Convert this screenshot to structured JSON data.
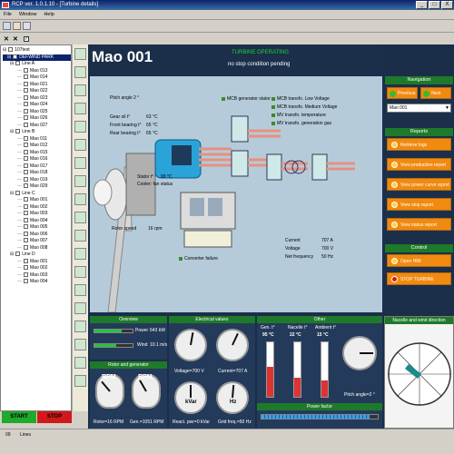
{
  "window": {
    "title": "RCP ver. 1.0.1.10 - [Turbine details]",
    "controls": [
      "_",
      "□",
      "X"
    ]
  },
  "menu": [
    "File",
    "Window",
    "Help"
  ],
  "tree": {
    "root": "107test",
    "park": "DEFWIND PARK",
    "lines": [
      {
        "label": "Line A",
        "items": [
          "Mao 013",
          "Mao 014",
          "Mao 021",
          "Mao 022",
          "Mao 023",
          "Mao 024",
          "Mao 025",
          "Mao 026",
          "Mao 027"
        ]
      },
      {
        "label": "Line B",
        "items": [
          "Mao 011",
          "Mao 012",
          "Mao 015",
          "Mao 016",
          "Mao 017",
          "Mao 018",
          "Mao 019",
          "Mao 029"
        ]
      },
      {
        "label": "Line C",
        "items": [
          "Mao 001",
          "Mao 002",
          "Mao 003",
          "Mao 004",
          "Mao 005",
          "Mao 006",
          "Mao 007",
          "Mao 008"
        ]
      },
      {
        "label": "Line D",
        "items": [
          "Mao 001",
          "Mao 002",
          "Mao 003",
          "Mao 004"
        ]
      }
    ]
  },
  "buttons": {
    "start": "START",
    "stop": "STOP"
  },
  "statusbar": {
    "left": "09",
    "right": "Lines"
  },
  "header": {
    "turbine": "Mao 001",
    "status": "TURBINE OPERATING",
    "substatus": "no stop condition pending"
  },
  "diagram": {
    "pitch_angle": "Pitch angle     2 °",
    "gear_oil": "Gear oil t°",
    "gear_oil_val": "63 °C",
    "front_bearing": "Front bearing t°",
    "front_bearing_val": "65 °C",
    "rear_bearing": "Rear bearing t°",
    "rear_bearing_val": "65 °C",
    "stator": "Stator t°",
    "stator_val": "90 °C",
    "cooler": "Cooler: fan status",
    "rotor_speed": "Rotor speed",
    "rotor_speed_val": "16 rpm",
    "converter_failure": "Converter failure",
    "legend": [
      "MCB generator stator",
      "MCB transfo. Low Voltage",
      "MCB transfo. Medium Voltage",
      "MV transfo. temperature",
      "MV transfo. generation gas"
    ],
    "current_lbl": "Current",
    "current_val": "707 A",
    "voltage_lbl": "Voltage",
    "voltage_val": "700 V",
    "netfreq_lbl": "Net frequency",
    "netfreq_val": "50 Hz"
  },
  "navigation": {
    "title": "Navigation",
    "previous": "Previous",
    "next": "Next",
    "selected": "Mao 001"
  },
  "reports": {
    "title": "Reports",
    "items": [
      "Retrieve logs",
      "View production report",
      "View power curve report",
      "View stop report",
      "View status report"
    ]
  },
  "control": {
    "title": "Control",
    "items": [
      "Open HMI",
      "STOP TURBINE"
    ]
  },
  "overview": {
    "title": "Overview",
    "power_lbl": "Power",
    "power_val": "643 kW",
    "wind_lbl": "Wind",
    "wind_val": "10.1 m/s",
    "power_fill": 0.72,
    "wind_fill": 0.58
  },
  "rotor_gen": {
    "title": "Rotor and generator",
    "rotor_unit": "RPM",
    "gen_unit": "RPM",
    "rotor_label": "Rotor=16 RPM",
    "gen_label": "Gen.=1051 RPM"
  },
  "electrical": {
    "title": "Electrical values",
    "voltage_label": "Voltage=700 V",
    "current_label": "Current=707 A",
    "kvar_unit": "kVar",
    "hz_unit": "Hz",
    "react_label": "React. pwr=0 kVar",
    "grid_label": "Grid freq.=50 Hz"
  },
  "other": {
    "title": "Other",
    "cols": [
      {
        "label": "Gen. t°",
        "val": "95 °C",
        "fill": 0.55
      },
      {
        "label": "Nacelle t°",
        "val": "22 °C",
        "fill": 0.35
      },
      {
        "label": "Ambient t°",
        "val": "15 °C",
        "fill": 0.3
      }
    ],
    "pitch_label": "Pitch angle=2 °",
    "power_factor": "Power factor",
    "pf_fill": 0.93
  },
  "nacelle": {
    "title": "Nacelle and wind direction"
  },
  "colors": {
    "accent_green": "#1e7a2a",
    "orange": "#f08a10",
    "panel_dark": "#1b2f4b",
    "start": "#1eaa2a",
    "stop": "#d21919"
  }
}
